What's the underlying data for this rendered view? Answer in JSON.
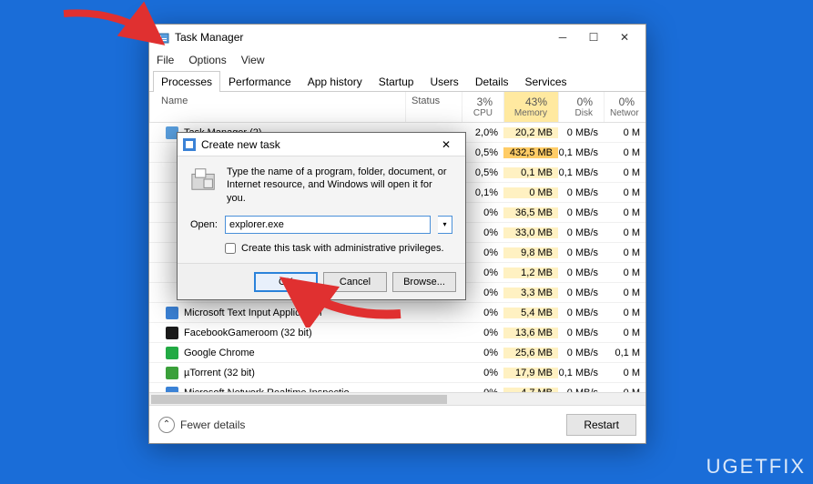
{
  "watermark": "UGETFIX",
  "taskmgr": {
    "title": "Task Manager",
    "menu": [
      "File",
      "Options",
      "View"
    ],
    "tabs": [
      "Processes",
      "Performance",
      "App history",
      "Startup",
      "Users",
      "Details",
      "Services"
    ],
    "active_tab": 0,
    "columns": {
      "name": "Name",
      "status": "Status",
      "cpu": {
        "pct": "3%",
        "label": "CPU"
      },
      "memory": {
        "pct": "43%",
        "label": "Memory"
      },
      "disk": {
        "pct": "0%",
        "label": "Disk"
      },
      "network": {
        "pct": "0%",
        "label": "Networ"
      }
    },
    "rows": [
      {
        "name": "Task Manager (2)",
        "icon": "#5aa0e0",
        "cpu": "2,0%",
        "mem": "20,2 MB",
        "mem_high": false,
        "disk": "0 MB/s",
        "net": "0 M"
      },
      {
        "name": "",
        "icon": "",
        "cpu": "0,5%",
        "mem": "432,5 MB",
        "mem_high": true,
        "disk": "0,1 MB/s",
        "net": "0 M"
      },
      {
        "name": "",
        "icon": "",
        "cpu": "0,5%",
        "mem": "0,1 MB",
        "mem_high": false,
        "disk": "0,1 MB/s",
        "net": "0 M"
      },
      {
        "name": "",
        "icon": "",
        "cpu": "0,1%",
        "mem": "0 MB",
        "mem_high": false,
        "disk": "0 MB/s",
        "net": "0 M"
      },
      {
        "name": "",
        "icon": "",
        "cpu": "0%",
        "mem": "36,5 MB",
        "mem_high": false,
        "disk": "0 MB/s",
        "net": "0 M"
      },
      {
        "name": "",
        "icon": "",
        "cpu": "0%",
        "mem": "33,0 MB",
        "mem_high": false,
        "disk": "0 MB/s",
        "net": "0 M"
      },
      {
        "name": "",
        "icon": "",
        "cpu": "0%",
        "mem": "9,8 MB",
        "mem_high": false,
        "disk": "0 MB/s",
        "net": "0 M"
      },
      {
        "name": "",
        "icon": "",
        "cpu": "0%",
        "mem": "1,2 MB",
        "mem_high": false,
        "disk": "0 MB/s",
        "net": "0 M"
      },
      {
        "name": "",
        "icon": "",
        "cpu": "0%",
        "mem": "3,3 MB",
        "mem_high": false,
        "disk": "0 MB/s",
        "net": "0 M"
      },
      {
        "name": "Microsoft Text Input Application",
        "icon": "#3b82d6",
        "cpu": "0%",
        "mem": "5,4 MB",
        "mem_high": false,
        "disk": "0 MB/s",
        "net": "0 M"
      },
      {
        "name": "FacebookGameroom (32 bit)",
        "icon": "#1a1a1a",
        "cpu": "0%",
        "mem": "13,6 MB",
        "mem_high": false,
        "disk": "0 MB/s",
        "net": "0 M"
      },
      {
        "name": "Google Chrome",
        "icon": "#22aa44",
        "cpu": "0%",
        "mem": "25,6 MB",
        "mem_high": false,
        "disk": "0 MB/s",
        "net": "0,1 M"
      },
      {
        "name": "µTorrent (32 bit)",
        "icon": "#3aa03a",
        "cpu": "0%",
        "mem": "17,9 MB",
        "mem_high": false,
        "disk": "0,1 MB/s",
        "net": "0 M"
      },
      {
        "name": "Microsoft Network Realtime Inspectio...",
        "icon": "#3b82d6",
        "cpu": "0%",
        "mem": "4,7 MB",
        "mem_high": false,
        "disk": "0 MB/s",
        "net": "0 M"
      }
    ],
    "fewer_details": "Fewer details",
    "restart": "Restart"
  },
  "dialog": {
    "title": "Create new task",
    "desc": "Type the name of a program, folder, document, or Internet resource, and Windows will open it for you.",
    "open_label": "Open:",
    "input_value": "explorer.exe",
    "admin_checkbox": "Create this task with administrative privileges.",
    "ok": "OK",
    "cancel": "Cancel",
    "browse": "Browse..."
  }
}
